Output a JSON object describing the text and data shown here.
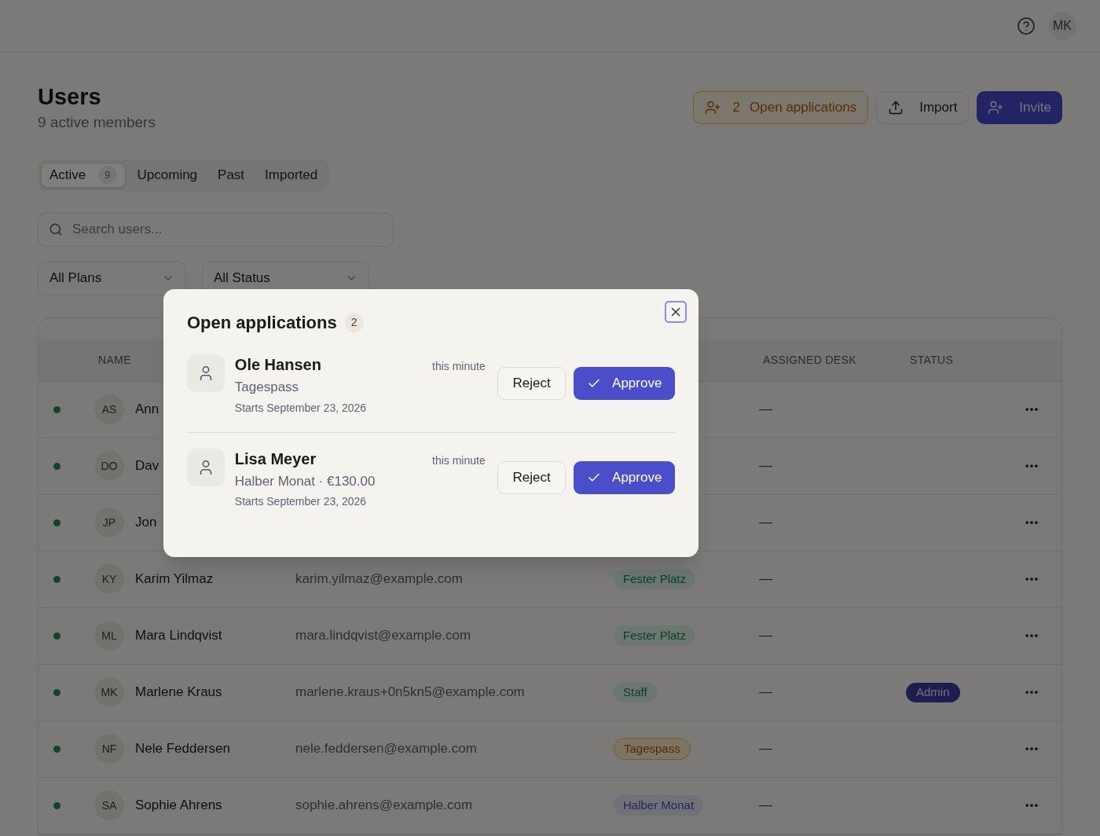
{
  "topbar": {
    "avatar": "MK"
  },
  "page": {
    "title": "Users",
    "subtitle": "9 active members"
  },
  "actions": {
    "applications": {
      "count": "2",
      "label": "Open applications"
    },
    "import": "Import",
    "invite": "Invite"
  },
  "tabs": [
    {
      "label": "Active",
      "count": "9",
      "selected": true
    },
    {
      "label": "Upcoming",
      "selected": false
    },
    {
      "label": "Past",
      "selected": false
    },
    {
      "label": "Imported",
      "selected": false
    }
  ],
  "search": {
    "placeholder": "Search users..."
  },
  "filters": [
    {
      "value": "All Plans"
    },
    {
      "value": "All Status"
    }
  ],
  "table": {
    "headers": {
      "name": "NAME",
      "desk": "ASSIGNED DESK",
      "status": "STATUS"
    },
    "rows": [
      {
        "active": true,
        "initials": "AS",
        "name": "Ann",
        "desk": "—"
      },
      {
        "active": true,
        "initials": "DO",
        "name": "Dav",
        "desk": "—"
      },
      {
        "active": true,
        "initials": "JP",
        "name": "Jon",
        "desk": "—"
      },
      {
        "active": true,
        "initials": "KY",
        "name": "Karim Yilmaz",
        "email": "karim.yilmaz@example.com",
        "plan": {
          "label": "Fester Platz",
          "kind": "success"
        },
        "desk": "—"
      },
      {
        "active": true,
        "initials": "ML",
        "name": "Mara Lindqvist",
        "email": "mara.lindqvist@example.com",
        "plan": {
          "label": "Fester Platz",
          "kind": "success"
        },
        "desk": "—"
      },
      {
        "active": true,
        "initials": "MK",
        "name": "Marlene Kraus",
        "email": "marlene.kraus+0n5kn5@example.com",
        "plan": {
          "label": "Staff",
          "kind": "success"
        },
        "desk": "—",
        "role": "Admin"
      },
      {
        "active": true,
        "initials": "NF",
        "name": "Nele Feddersen",
        "email": "nele.feddersen@example.com",
        "plan": {
          "label": "Tagespass",
          "kind": "warning"
        },
        "desk": "—"
      },
      {
        "active": true,
        "initials": "SA",
        "name": "Sophie Ahrens",
        "email": "sophie.ahrens@example.com",
        "plan": {
          "label": "Halber Monat",
          "kind": "accent"
        },
        "desk": "—"
      }
    ]
  },
  "dialog": {
    "title": "Open applications",
    "count": "2",
    "applications": [
      {
        "name": "Ole Hansen",
        "time": "this minute",
        "plan": "Tagespass",
        "start": "Starts September 23, 2026",
        "reject": "Reject",
        "approve": "Approve"
      },
      {
        "name": "Lisa Meyer",
        "time": "this minute",
        "plan": "Halber Monat · €130.00",
        "start": "Starts September 23, 2026",
        "reject": "Reject",
        "approve": "Approve"
      }
    ]
  }
}
